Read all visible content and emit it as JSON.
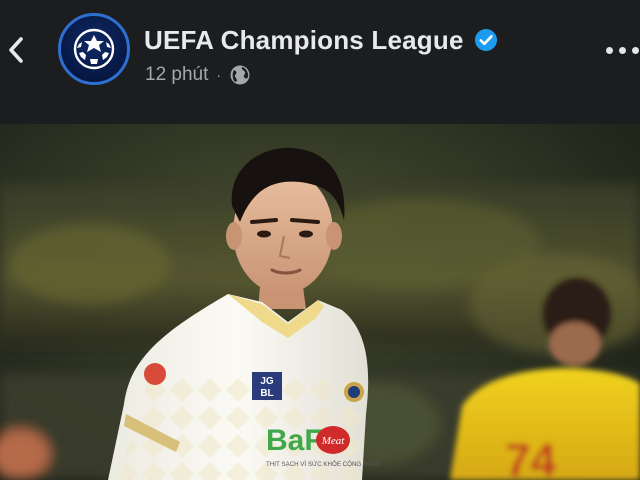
{
  "post": {
    "page_name": "UEFA Champions League",
    "time": "12 phút",
    "separator": "·",
    "verified_icon": "verified-badge-icon",
    "audience_icon": "globe-icon"
  },
  "nav": {
    "back_icon": "chevron-left-icon",
    "more_icon": "more-horizontal-icon"
  },
  "photo": {
    "jersey_sponsor_top_line1": "JG",
    "jersey_sponsor_top_line2": "BL",
    "jersey_sponsor_main": "BaF",
    "jersey_sponsor_badge": "Meat",
    "jersey_sponsor_tagline": "THỊT SẠCH VÌ SỨC KHỎE CỘNG ĐỒNG"
  },
  "colors": {
    "background": "#1c1d1f",
    "name_text": "#e8e9eb",
    "meta_text": "#a4a7ac",
    "verified": "#1d9bf0",
    "avatar_ring": "#2f6fd1"
  }
}
